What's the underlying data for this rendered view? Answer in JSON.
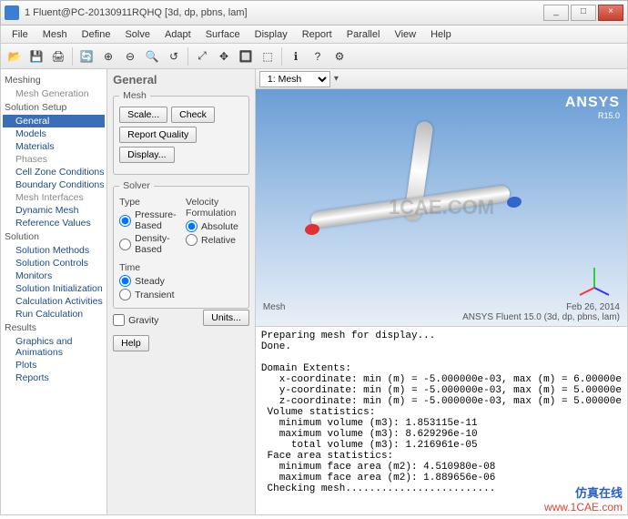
{
  "window": {
    "title": "1 Fluent@PC-20130911RQHQ  [3d, dp, pbns, lam]",
    "min": "_",
    "max": "□",
    "close": "×"
  },
  "menus": [
    "File",
    "Mesh",
    "Define",
    "Solve",
    "Adapt",
    "Surface",
    "Display",
    "Report",
    "Parallel",
    "View",
    "Help"
  ],
  "toolbar_icons": [
    "📂",
    "💾",
    "🖨",
    "|",
    "🔄",
    "⊕",
    "⊖",
    "🔍",
    "↺",
    "|",
    "⤢",
    "✥",
    "🔲",
    "⬚",
    "|",
    "ℹ",
    "?",
    "⚙"
  ],
  "nav": {
    "sections": [
      {
        "header": "Meshing",
        "items": [
          {
            "label": "Mesh Generation",
            "dim": true
          }
        ]
      },
      {
        "header": "Solution Setup",
        "items": [
          {
            "label": "General",
            "active": true
          },
          {
            "label": "Models"
          },
          {
            "label": "Materials"
          },
          {
            "label": "Phases",
            "dim": true
          },
          {
            "label": "Cell Zone Conditions"
          },
          {
            "label": "Boundary Conditions"
          },
          {
            "label": "Mesh Interfaces",
            "dim": true
          },
          {
            "label": "Dynamic Mesh"
          },
          {
            "label": "Reference Values"
          }
        ]
      },
      {
        "header": "Solution",
        "items": [
          {
            "label": "Solution Methods"
          },
          {
            "label": "Solution Controls"
          },
          {
            "label": "Monitors"
          },
          {
            "label": "Solution Initialization"
          },
          {
            "label": "Calculation Activities"
          },
          {
            "label": "Run Calculation"
          }
        ]
      },
      {
        "header": "Results",
        "items": [
          {
            "label": "Graphics and Animations"
          },
          {
            "label": "Plots"
          },
          {
            "label": "Reports"
          }
        ]
      }
    ]
  },
  "panel": {
    "title": "General",
    "mesh_legend": "Mesh",
    "btn_scale": "Scale...",
    "btn_check": "Check",
    "btn_report": "Report Quality",
    "btn_display": "Display...",
    "solver_legend": "Solver",
    "type_label": "Type",
    "type_opts": [
      "Pressure-Based",
      "Density-Based"
    ],
    "type_sel": 0,
    "vf_label": "Velocity Formulation",
    "vf_opts": [
      "Absolute",
      "Relative"
    ],
    "vf_sel": 0,
    "time_label": "Time",
    "time_opts": [
      "Steady",
      "Transient"
    ],
    "time_sel": 0,
    "gravity": "Gravity",
    "units": "Units...",
    "help": "Help"
  },
  "viewport": {
    "dropdown": "1: Mesh",
    "brand": "ANSYS",
    "brand_sub": "R15.0",
    "footer_left": "Mesh",
    "footer_date": "Feb 26, 2014",
    "footer_info": "ANSYS Fluent 15.0  (3d, dp, pbns, lam)",
    "watermark": "1CAE.COM"
  },
  "console_text": "Preparing mesh for display...\nDone.\n\nDomain Extents:\n   x-coordinate: min (m) = -5.000000e-03, max (m) = 6.00000e\n   y-coordinate: min (m) = -5.000000e-03, max (m) = 5.00000e\n   z-coordinate: min (m) = -5.000000e-03, max (m) = 5.00000e\n Volume statistics:\n   minimum volume (m3): 1.853115e-11\n   maximum volume (m3): 8.629296e-10\n     total volume (m3): 1.216961e-05\n Face area statistics:\n   minimum face area (m2): 4.510980e-08\n   maximum face area (m2): 1.889656e-06\n Checking mesh.........................",
  "site": {
    "cn": "仿真在线",
    "url": "www.1CAE.com"
  }
}
